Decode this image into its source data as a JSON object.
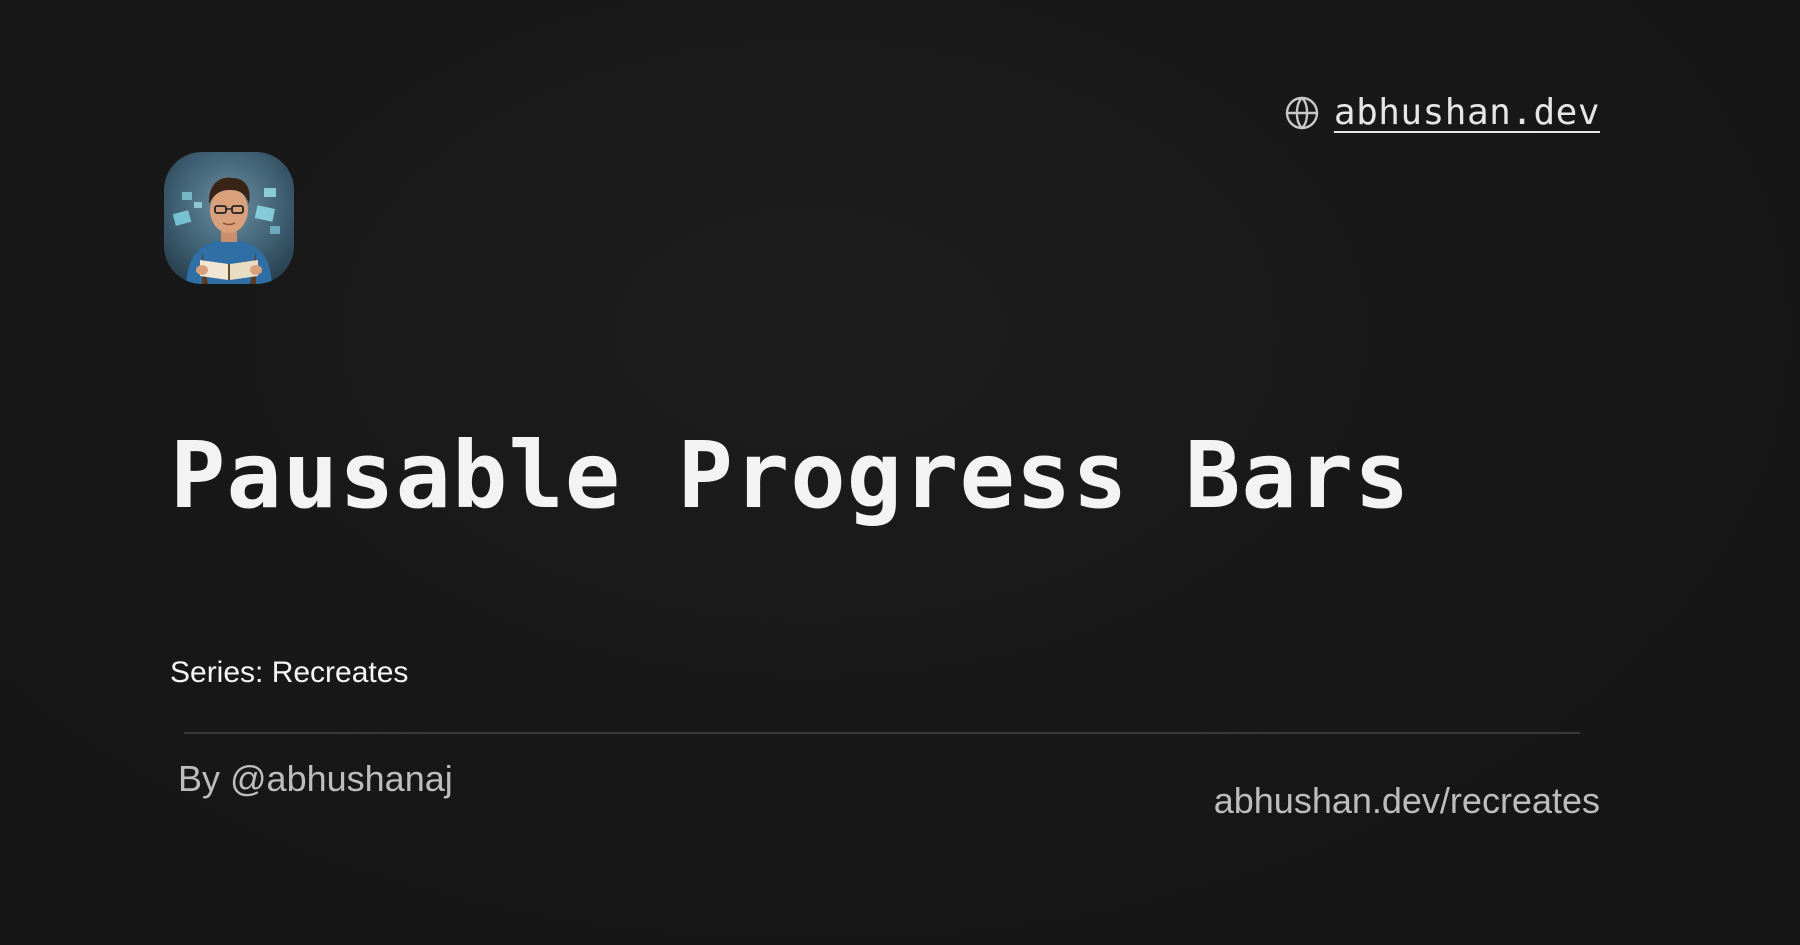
{
  "header": {
    "site_link": "abhushan.dev",
    "site_icon": "globe-icon"
  },
  "avatar": {
    "description_icon": "avatar-illustration"
  },
  "main": {
    "title": "Pausable Progress Bars",
    "series_label": "Series: Recreates"
  },
  "footer": {
    "author": "By @abhushanaj",
    "series_url": "abhushan.dev/recreates"
  },
  "colors": {
    "background": "#171717",
    "text_primary": "#f3f3f3",
    "text_muted": "#bdbdbd",
    "divider": "#3a3a3a"
  }
}
